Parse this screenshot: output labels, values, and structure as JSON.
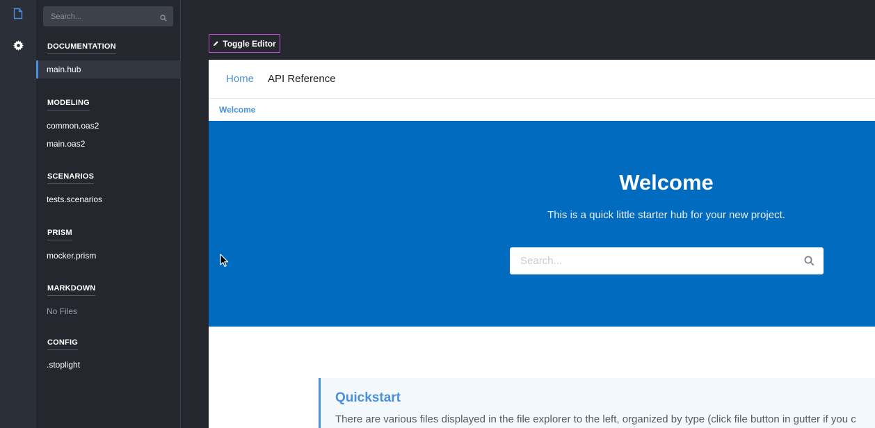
{
  "gutter": {
    "files_icon": "file-icon",
    "settings_icon": "gear-icon"
  },
  "sidebar": {
    "search_placeholder": "Search...",
    "sections": {
      "documentation": {
        "title": "DOCUMENTATION",
        "items": [
          "main.hub"
        ]
      },
      "modeling": {
        "title": "MODELING",
        "items": [
          "common.oas2",
          "main.oas2"
        ]
      },
      "scenarios": {
        "title": "SCENARIOS",
        "items": [
          "tests.scenarios"
        ]
      },
      "prism": {
        "title": "PRISM",
        "items": [
          "mocker.prism"
        ]
      },
      "markdown": {
        "title": "MARKDOWN",
        "empty": "No Files"
      },
      "config": {
        "title": "CONFIG",
        "items": [
          ".stoplight"
        ]
      }
    }
  },
  "toolbar": {
    "toggle_editor_label": "Toggle Editor"
  },
  "preview": {
    "nav": {
      "home": "Home",
      "api": "API Reference"
    },
    "breadcrumb": "Welcome",
    "hero": {
      "title": "Welcome",
      "subtitle": "This is a quick little starter hub for your new project.",
      "search_placeholder": "Search..."
    },
    "quickstart": {
      "title": "Quickstart",
      "text": "There are various files displayed in the file explorer to the left, organized by type (click file button in gutter if you c"
    }
  },
  "colors": {
    "accent": "#4a90d9",
    "hero_bg": "#006bbf",
    "toggle_border": "#c64fe0",
    "sidebar_bg": "#24272e"
  }
}
